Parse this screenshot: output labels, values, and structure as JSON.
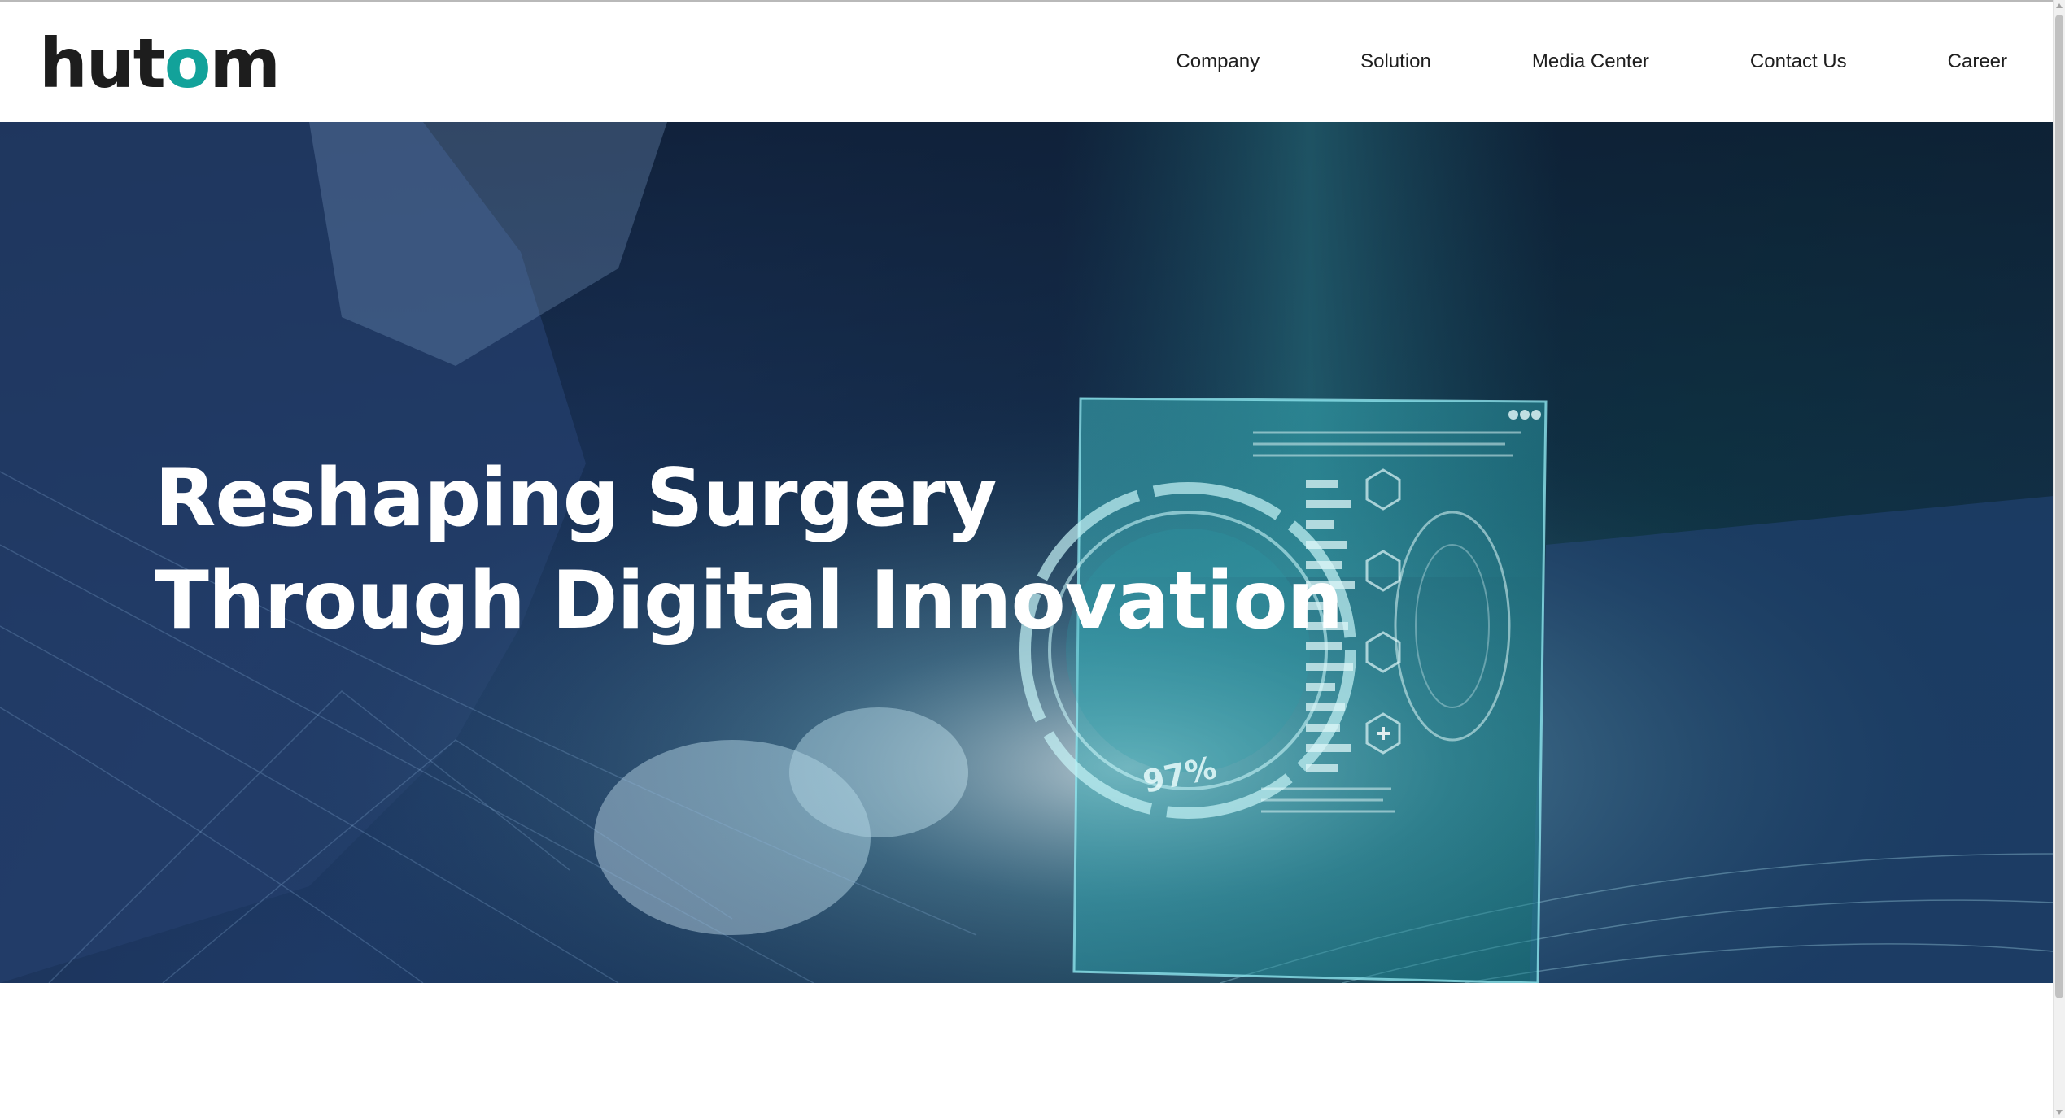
{
  "brand": {
    "logo_prefix": "hut",
    "logo_accent": "o",
    "logo_suffix": "m",
    "accent_color": "#12a29a"
  },
  "nav": {
    "items": [
      {
        "label": "Company"
      },
      {
        "label": "Solution"
      },
      {
        "label": "Media Center"
      },
      {
        "label": "Contact Us"
      },
      {
        "label": "Career"
      }
    ]
  },
  "hero": {
    "title_line1": "Reshaping Surgery",
    "title_line2": "Through Digital Innovation",
    "hud_readout": "97%",
    "background_image": "surgeons-operating-with-holographic-display"
  },
  "colors": {
    "text": "#1e1e1e",
    "hero_overlay": "#1e3a66",
    "hologram": "#3fc6c8"
  }
}
